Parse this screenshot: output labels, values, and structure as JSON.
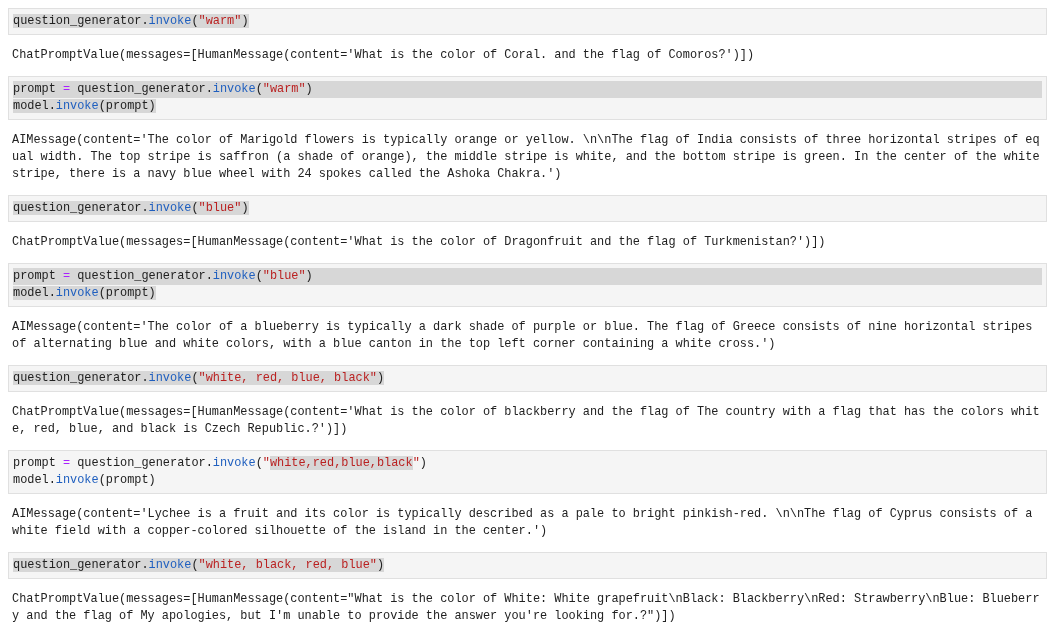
{
  "cells": [
    {
      "code": [
        {
          "tokens": [
            {
              "kind": "plain",
              "text": "question_generator.",
              "highlighted": true
            },
            {
              "kind": "func",
              "text": "invoke",
              "highlighted": true
            },
            {
              "kind": "plain",
              "text": "(",
              "highlighted": true
            },
            {
              "kind": "string",
              "text": "\"warm\"",
              "highlighted": true
            },
            {
              "kind": "plain",
              "text": ")",
              "highlighted": true
            }
          ]
        }
      ],
      "output": [
        "ChatPromptValue(messages=[HumanMessage(content='What is the color of Coral. and the flag of Comoros?')])"
      ]
    },
    {
      "code": [
        {
          "row_highlight": true,
          "tokens": [
            {
              "kind": "plain",
              "text": "prompt "
            },
            {
              "kind": "op",
              "text": "="
            },
            {
              "kind": "plain",
              "text": " question_generator."
            },
            {
              "kind": "func",
              "text": "invoke"
            },
            {
              "kind": "plain",
              "text": "("
            },
            {
              "kind": "string",
              "text": "\"warm\""
            },
            {
              "kind": "plain",
              "text": ")"
            }
          ]
        },
        {
          "tokens": [
            {
              "kind": "plain",
              "text": "model.",
              "highlighted": true
            },
            {
              "kind": "func",
              "text": "invoke",
              "highlighted": true
            },
            {
              "kind": "plain",
              "text": "(prompt)",
              "highlighted": true
            }
          ]
        }
      ],
      "output": [
        "AIMessage(content='The color of Marigold flowers is typically orange or yellow. \\n\\nThe flag of India consists of three horizontal stripes of eq",
        "ual width. The top stripe is saffron (a shade of orange), the middle stripe is white, and the bottom stripe is green. In the center of the white",
        "stripe, there is a navy blue wheel with 24 spokes called the Ashoka Chakra.')"
      ]
    },
    {
      "code": [
        {
          "tokens": [
            {
              "kind": "plain",
              "text": "question_generator.",
              "highlighted": true
            },
            {
              "kind": "func",
              "text": "invoke",
              "highlighted": true
            },
            {
              "kind": "plain",
              "text": "(",
              "highlighted": true
            },
            {
              "kind": "string",
              "text": "\"blue\"",
              "highlighted": true
            },
            {
              "kind": "plain",
              "text": ")",
              "highlighted": true
            }
          ]
        }
      ],
      "output": [
        "ChatPromptValue(messages=[HumanMessage(content='What is the color of Dragonfruit and the flag of Turkmenistan?')])"
      ]
    },
    {
      "code": [
        {
          "row_highlight": true,
          "tokens": [
            {
              "kind": "plain",
              "text": "prompt "
            },
            {
              "kind": "op",
              "text": "="
            },
            {
              "kind": "plain",
              "text": " question_generator."
            },
            {
              "kind": "func",
              "text": "invoke"
            },
            {
              "kind": "plain",
              "text": "("
            },
            {
              "kind": "string",
              "text": "\"blue\""
            },
            {
              "kind": "plain",
              "text": ")"
            }
          ]
        },
        {
          "tokens": [
            {
              "kind": "plain",
              "text": "model.",
              "highlighted": true
            },
            {
              "kind": "func",
              "text": "invoke",
              "highlighted": true
            },
            {
              "kind": "plain",
              "text": "(prompt)",
              "highlighted": true
            }
          ]
        }
      ],
      "output": [
        "AIMessage(content='The color of a blueberry is typically a dark shade of purple or blue. The flag of Greece consists of nine horizontal stripes",
        "of alternating blue and white colors, with a blue canton in the top left corner containing a white cross.')"
      ]
    },
    {
      "code": [
        {
          "tokens": [
            {
              "kind": "plain",
              "text": "question_generator.",
              "highlighted": true
            },
            {
              "kind": "func",
              "text": "invoke",
              "highlighted": true
            },
            {
              "kind": "plain",
              "text": "(",
              "highlighted": true
            },
            {
              "kind": "string",
              "text": "\"white, red, blue, black\"",
              "highlighted": true
            },
            {
              "kind": "plain",
              "text": ")",
              "highlighted": true
            }
          ]
        }
      ],
      "output": [
        "ChatPromptValue(messages=[HumanMessage(content='What is the color of blackberry and the flag of The country with a flag that has the colors whit",
        "e, red, blue, and black is Czech Republic.?')])"
      ]
    },
    {
      "code": [
        {
          "tokens": [
            {
              "kind": "plain",
              "text": "prompt ",
              "highlighted": false
            },
            {
              "kind": "op",
              "text": "=",
              "highlighted": false
            },
            {
              "kind": "plain",
              "text": " question_generator.",
              "highlighted": false
            },
            {
              "kind": "func",
              "text": "invoke",
              "highlighted": false
            },
            {
              "kind": "plain",
              "text": "(",
              "highlighted": false
            },
            {
              "kind": "string",
              "text": "\"",
              "highlighted": false
            },
            {
              "kind": "string",
              "text": "white,red,blue,black",
              "highlighted": true
            },
            {
              "kind": "string",
              "text": "\"",
              "highlighted": false
            },
            {
              "kind": "plain",
              "text": ")",
              "highlighted": false
            }
          ]
        },
        {
          "tokens": [
            {
              "kind": "plain",
              "text": "model.",
              "highlighted": false
            },
            {
              "kind": "func",
              "text": "invoke",
              "highlighted": false
            },
            {
              "kind": "plain",
              "text": "(prompt)",
              "highlighted": false
            }
          ]
        }
      ],
      "output": [
        "AIMessage(content='Lychee is a fruit and its color is typically described as a pale to bright pinkish-red. \\n\\nThe flag of Cyprus consists of a",
        "white field with a copper-colored silhouette of the island in the center.')"
      ]
    },
    {
      "code": [
        {
          "tokens": [
            {
              "kind": "plain",
              "text": "question_generator.",
              "highlighted": true
            },
            {
              "kind": "func",
              "text": "invoke",
              "highlighted": true
            },
            {
              "kind": "plain",
              "text": "(",
              "highlighted": true
            },
            {
              "kind": "string",
              "text": "\"white, black, red, blue\"",
              "highlighted": true
            },
            {
              "kind": "plain",
              "text": ")",
              "highlighted": true
            }
          ]
        }
      ],
      "output": [
        "ChatPromptValue(messages=[HumanMessage(content=\"What is the color of White: White grapefruit\\nBlack: Blackberry\\nRed: Strawberry\\nBlue: Blueberr",
        "y and the flag of My apologies, but I'm unable to provide the answer you're looking for.?\")])"
      ]
    }
  ]
}
